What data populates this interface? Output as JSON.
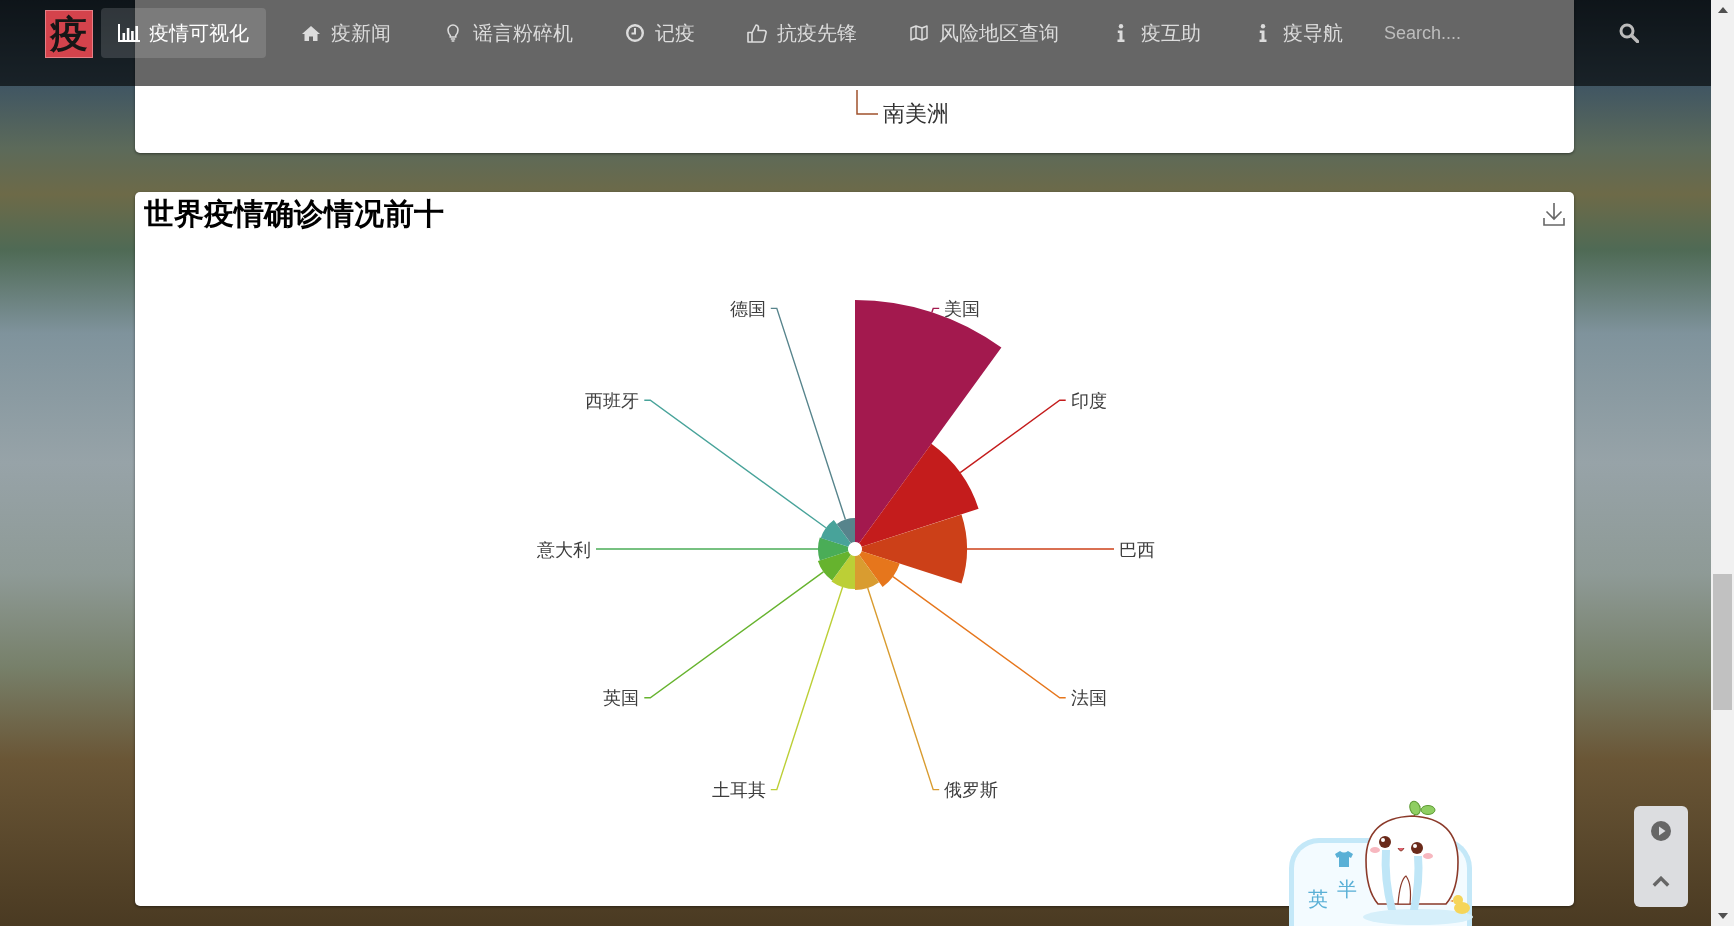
{
  "nav": {
    "logo": "疫",
    "items": [
      {
        "label": "疫情可视化",
        "selected": true
      },
      {
        "label": "疫新闻",
        "selected": false
      },
      {
        "label": "谣言粉碎机",
        "selected": false
      },
      {
        "label": "记疫",
        "selected": false
      },
      {
        "label": "抗疫先锋",
        "selected": false
      },
      {
        "label": "风险地区查询",
        "selected": false
      },
      {
        "label": "疫互助",
        "selected": false
      },
      {
        "label": "疫导航",
        "selected": false
      }
    ],
    "search": {
      "placeholder": "Search...."
    }
  },
  "top_chart": {
    "labels": [
      "南美洲"
    ]
  },
  "chart": {
    "title": "世界疫情确诊情况前十",
    "slices": [
      {
        "label": "美国",
        "color": "#a3194e"
      },
      {
        "label": "印度",
        "color": "#c41c1c"
      },
      {
        "label": "巴西",
        "color": "#cc4018"
      },
      {
        "label": "法国",
        "color": "#e6761c"
      },
      {
        "label": "俄罗斯",
        "color": "#d99c30"
      },
      {
        "label": "土耳其",
        "color": "#bccf36"
      },
      {
        "label": "英国",
        "color": "#66b32e"
      },
      {
        "label": "意大利",
        "color": "#4aad57"
      },
      {
        "label": "西班牙",
        "color": "#48a39a"
      },
      {
        "label": "德国",
        "color": "#57848c"
      }
    ]
  },
  "mascot_sticker": {
    "texts": [
      "英",
      "半"
    ]
  }
}
